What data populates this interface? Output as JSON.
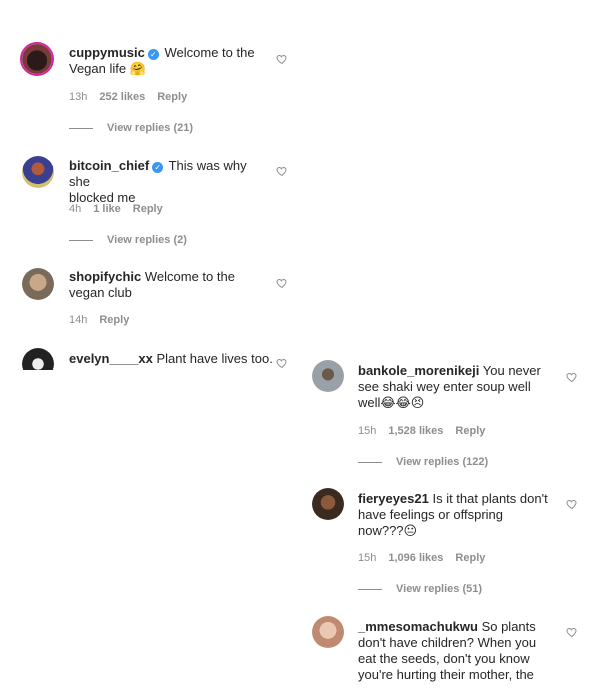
{
  "comments_left": [
    {
      "username": "cuppymusic",
      "verified": true,
      "text_line1": "Welcome to the",
      "text_line2": "Vegan life",
      "emoji": "🤗",
      "time": "13h",
      "likes": "252 likes",
      "reply": "Reply",
      "view_replies": "View replies (21)",
      "avatar_icon": "avatar-cuppymusic"
    },
    {
      "username": "bitcoin_chief",
      "verified": true,
      "text_line1": "This was why she",
      "text_line2": "blocked me",
      "time": "4h",
      "likes": "1 like",
      "reply": "Reply",
      "view_replies": "View replies (2)",
      "avatar_icon": "avatar-bitcoin-chief"
    },
    {
      "username": "shopifychic",
      "text_line1": "Welcome to the",
      "text_line2": "vegan club",
      "time": "14h",
      "reply": "Reply",
      "avatar_icon": "avatar-shopifychic"
    },
    {
      "username": "evelyn____xx",
      "text_line1": "Plant have lives too.",
      "avatar_icon": "avatar-evelyn"
    }
  ],
  "comments_right": [
    {
      "username": "bankole_morenikeji",
      "text_line1": "You never",
      "text_line2": "see shaki wey enter soup well",
      "text_line3": "well",
      "emoji": "😂😂😣",
      "time": "15h",
      "likes": "1,528 likes",
      "reply": "Reply",
      "view_replies": "View replies (122)"
    },
    {
      "username": "fieryeyes21",
      "text_line1": "Is it that plants don't",
      "text_line2": "have feelings or offspring",
      "text_line3": "now???",
      "emoji": "😐",
      "time": "15h",
      "likes": "1,096 likes",
      "reply": "Reply",
      "view_replies": "View replies (51)"
    },
    {
      "username": "_mmesomachukwu",
      "text_line1": "So plants",
      "text_line2": "don't have children? When you",
      "text_line3": "eat the seeds, don't you know",
      "text_line4": "you're hurting their mother, the"
    }
  ],
  "icons": {
    "heart": "heart-outline-icon",
    "verified": "verified-badge-icon"
  },
  "colors": {
    "text": "#262626",
    "meta": "#8e8e8e",
    "verified": "#3897f0"
  }
}
